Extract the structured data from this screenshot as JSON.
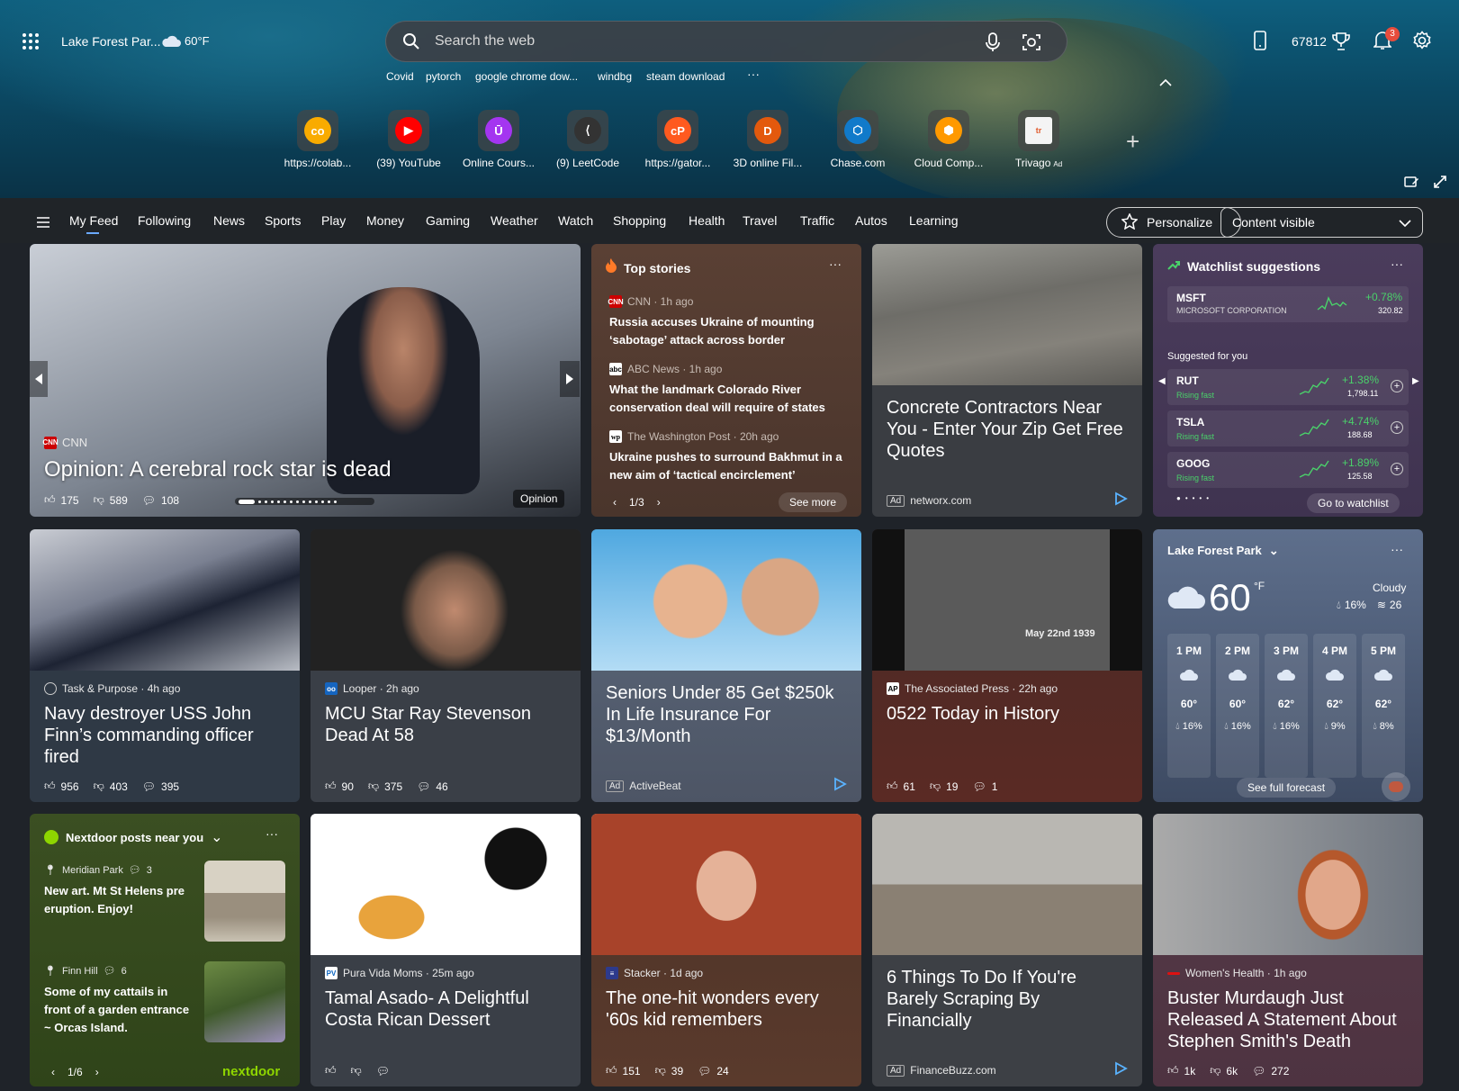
{
  "header": {
    "location": "Lake Forest Par...",
    "temp": "60°F",
    "search_placeholder": "Search the web",
    "points": "67812",
    "notif_count": "3",
    "trending": [
      "Covid",
      "pytorch",
      "google chrome dow...",
      "windbg",
      "steam download"
    ],
    "quick_links": [
      {
        "label": "https://colab...",
        "color": "#f9ab00",
        "text": "co"
      },
      {
        "label": "(39) YouTube",
        "color": "#ff0000",
        "text": "▶"
      },
      {
        "label": "Online Cours...",
        "color": "#a435f0",
        "text": "Ū"
      },
      {
        "label": "(9) LeetCode",
        "color": "#333333",
        "text": "⟨"
      },
      {
        "label": "https://gator...",
        "color": "#ff5a1f",
        "text": "cP"
      },
      {
        "label": "3D online Fil...",
        "color": "#e3590d",
        "text": "D"
      },
      {
        "label": "Chase.com",
        "color": "#117aca",
        "text": "⬡"
      },
      {
        "label": "Cloud Comp...",
        "color": "#ff9900",
        "text": "⬢"
      },
      {
        "label": "Trivago",
        "color": "#f4f4f4",
        "text": "tr"
      }
    ],
    "trivago_ad": "Ad"
  },
  "nav": {
    "tabs": [
      "My Feed",
      "Following",
      "News",
      "Sports",
      "Play",
      "Money",
      "Gaming",
      "Weather",
      "Watch",
      "Shopping",
      "Health",
      "Travel",
      "Traffic",
      "Autos",
      "Learning"
    ],
    "personalize": "Personalize",
    "content_visible": "Content visible"
  },
  "hero_card": {
    "source": "CNN",
    "title": "Opinion: A cerebral rock star is dead",
    "likes": "175",
    "dislikes": "589",
    "comments": "108",
    "tag": "Opinion"
  },
  "top_stories": {
    "header": "Top stories",
    "items": [
      {
        "source": "CNN · 1h ago",
        "title": "Russia accuses Ukraine of mounting ‘sabotage’ attack across border"
      },
      {
        "source": "ABC News · 1h ago",
        "title": "What the landmark Colorado River conservation deal will require of states"
      },
      {
        "source": "The Washington Post · 20h ago",
        "title": "Ukraine pushes to surround Bakhmut in a new aim of ‘tactical encirclement’"
      }
    ],
    "pager": "1/3",
    "see_more": "See more"
  },
  "concrete_ad": {
    "title": "Concrete Contractors Near You - Enter Your Zip Get Free Quotes",
    "ad": "Ad",
    "domain": "networx.com"
  },
  "watchlist": {
    "header": "Watchlist suggestions",
    "main": {
      "symbol": "MSFT",
      "name": "MICROSOFT CORPORATION",
      "change": "+0.78%",
      "price": "320.82"
    },
    "suggested_label": "Suggested for you",
    "items": [
      {
        "symbol": "RUT",
        "tag": "Rising fast",
        "change": "+1.38%",
        "price": "1,798.11"
      },
      {
        "symbol": "TSLA",
        "tag": "Rising fast",
        "change": "+4.74%",
        "price": "188.68"
      },
      {
        "symbol": "GOOG",
        "tag": "Rising fast",
        "change": "+1.89%",
        "price": "125.58"
      }
    ],
    "go": "Go to watchlist"
  },
  "row2": [
    {
      "source": "Task & Purpose · 4h ago",
      "title": "Navy destroyer USS John Finn’s commanding officer fired",
      "likes": "956",
      "dislikes": "403",
      "comments": "395"
    },
    {
      "source": "Looper · 2h ago",
      "title": "MCU Star Ray Stevenson Dead At 58",
      "likes": "90",
      "dislikes": "375",
      "comments": "46"
    },
    {
      "source": "",
      "title": "Seniors Under 85 Get $250k In Life Insurance For $13/Month",
      "ad": "Ad",
      "domain": "ActiveBeat"
    },
    {
      "source": "The Associated Press · 22h ago",
      "title": "0522 Today in History",
      "likes": "61",
      "dislikes": "19",
      "comments": "1",
      "img_caption": "May 22nd 1939"
    }
  ],
  "weather": {
    "location": "Lake Forest Park",
    "temp": "60",
    "unit": "°F",
    "cond": "Cloudy",
    "precip": "16%",
    "wind": "26",
    "hours": [
      {
        "h": "1 PM",
        "t": "60°",
        "p": "16%"
      },
      {
        "h": "2 PM",
        "t": "60°",
        "p": "16%"
      },
      {
        "h": "3 PM",
        "t": "62°",
        "p": "16%"
      },
      {
        "h": "4 PM",
        "t": "62°",
        "p": "9%"
      },
      {
        "h": "5 PM",
        "t": "62°",
        "p": "8%"
      }
    ],
    "see_full": "See full forecast"
  },
  "nextdoor": {
    "header": "Nextdoor posts near you",
    "posts": [
      {
        "place": "Meridian Park",
        "count": "3",
        "text": "New art. Mt St Helens pre eruption. Enjoy!"
      },
      {
        "place": "Finn Hill",
        "count": "6",
        "text": "Some of my cattails in front of a garden entrance ~ Orcas Island."
      }
    ],
    "pager": "1/6",
    "brand": "nextdoor"
  },
  "row3": [
    {
      "source": "Pura Vida Moms · 25m ago",
      "title": "Tamal Asado- A Delightful Costa Rican Dessert"
    },
    {
      "source": "Stacker · 1d ago",
      "title": "The one-hit wonders every '60s kid remembers",
      "likes": "151",
      "dislikes": "39",
      "comments": "24"
    },
    {
      "title": "6 Things To Do If You're Barely Scraping By Financially",
      "ad": "Ad",
      "domain": "FinanceBuzz.com"
    },
    {
      "source": "Women's Health · 1h ago",
      "title": "Buster Murdaugh Just Released A Statement About Stephen Smith's Death",
      "likes": "1k",
      "dislikes": "6k",
      "comments": "272"
    }
  ]
}
